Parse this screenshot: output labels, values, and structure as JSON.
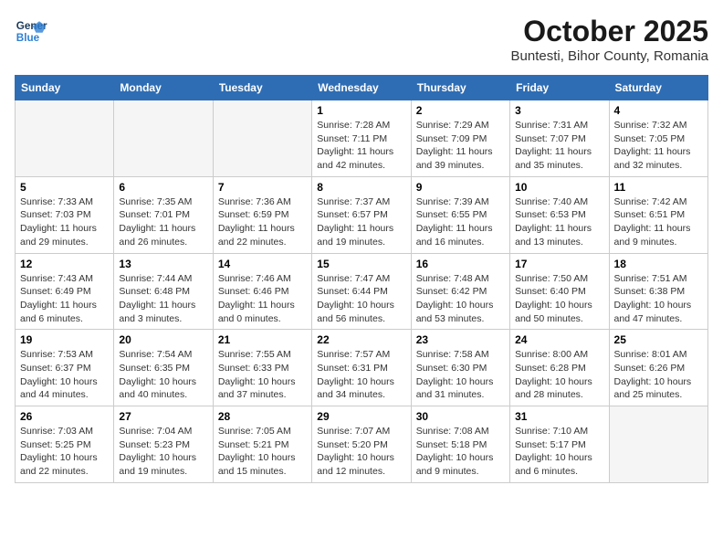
{
  "logo": {
    "line1": "General",
    "line2": "Blue"
  },
  "title": "October 2025",
  "subtitle": "Buntesti, Bihor County, Romania",
  "weekdays": [
    "Sunday",
    "Monday",
    "Tuesday",
    "Wednesday",
    "Thursday",
    "Friday",
    "Saturday"
  ],
  "weeks": [
    [
      {
        "day": "",
        "info": ""
      },
      {
        "day": "",
        "info": ""
      },
      {
        "day": "",
        "info": ""
      },
      {
        "day": "1",
        "info": "Sunrise: 7:28 AM\nSunset: 7:11 PM\nDaylight: 11 hours\nand 42 minutes."
      },
      {
        "day": "2",
        "info": "Sunrise: 7:29 AM\nSunset: 7:09 PM\nDaylight: 11 hours\nand 39 minutes."
      },
      {
        "day": "3",
        "info": "Sunrise: 7:31 AM\nSunset: 7:07 PM\nDaylight: 11 hours\nand 35 minutes."
      },
      {
        "day": "4",
        "info": "Sunrise: 7:32 AM\nSunset: 7:05 PM\nDaylight: 11 hours\nand 32 minutes."
      }
    ],
    [
      {
        "day": "5",
        "info": "Sunrise: 7:33 AM\nSunset: 7:03 PM\nDaylight: 11 hours\nand 29 minutes."
      },
      {
        "day": "6",
        "info": "Sunrise: 7:35 AM\nSunset: 7:01 PM\nDaylight: 11 hours\nand 26 minutes."
      },
      {
        "day": "7",
        "info": "Sunrise: 7:36 AM\nSunset: 6:59 PM\nDaylight: 11 hours\nand 22 minutes."
      },
      {
        "day": "8",
        "info": "Sunrise: 7:37 AM\nSunset: 6:57 PM\nDaylight: 11 hours\nand 19 minutes."
      },
      {
        "day": "9",
        "info": "Sunrise: 7:39 AM\nSunset: 6:55 PM\nDaylight: 11 hours\nand 16 minutes."
      },
      {
        "day": "10",
        "info": "Sunrise: 7:40 AM\nSunset: 6:53 PM\nDaylight: 11 hours\nand 13 minutes."
      },
      {
        "day": "11",
        "info": "Sunrise: 7:42 AM\nSunset: 6:51 PM\nDaylight: 11 hours\nand 9 minutes."
      }
    ],
    [
      {
        "day": "12",
        "info": "Sunrise: 7:43 AM\nSunset: 6:49 PM\nDaylight: 11 hours\nand 6 minutes."
      },
      {
        "day": "13",
        "info": "Sunrise: 7:44 AM\nSunset: 6:48 PM\nDaylight: 11 hours\nand 3 minutes."
      },
      {
        "day": "14",
        "info": "Sunrise: 7:46 AM\nSunset: 6:46 PM\nDaylight: 11 hours\nand 0 minutes."
      },
      {
        "day": "15",
        "info": "Sunrise: 7:47 AM\nSunset: 6:44 PM\nDaylight: 10 hours\nand 56 minutes."
      },
      {
        "day": "16",
        "info": "Sunrise: 7:48 AM\nSunset: 6:42 PM\nDaylight: 10 hours\nand 53 minutes."
      },
      {
        "day": "17",
        "info": "Sunrise: 7:50 AM\nSunset: 6:40 PM\nDaylight: 10 hours\nand 50 minutes."
      },
      {
        "day": "18",
        "info": "Sunrise: 7:51 AM\nSunset: 6:38 PM\nDaylight: 10 hours\nand 47 minutes."
      }
    ],
    [
      {
        "day": "19",
        "info": "Sunrise: 7:53 AM\nSunset: 6:37 PM\nDaylight: 10 hours\nand 44 minutes."
      },
      {
        "day": "20",
        "info": "Sunrise: 7:54 AM\nSunset: 6:35 PM\nDaylight: 10 hours\nand 40 minutes."
      },
      {
        "day": "21",
        "info": "Sunrise: 7:55 AM\nSunset: 6:33 PM\nDaylight: 10 hours\nand 37 minutes."
      },
      {
        "day": "22",
        "info": "Sunrise: 7:57 AM\nSunset: 6:31 PM\nDaylight: 10 hours\nand 34 minutes."
      },
      {
        "day": "23",
        "info": "Sunrise: 7:58 AM\nSunset: 6:30 PM\nDaylight: 10 hours\nand 31 minutes."
      },
      {
        "day": "24",
        "info": "Sunrise: 8:00 AM\nSunset: 6:28 PM\nDaylight: 10 hours\nand 28 minutes."
      },
      {
        "day": "25",
        "info": "Sunrise: 8:01 AM\nSunset: 6:26 PM\nDaylight: 10 hours\nand 25 minutes."
      }
    ],
    [
      {
        "day": "26",
        "info": "Sunrise: 7:03 AM\nSunset: 5:25 PM\nDaylight: 10 hours\nand 22 minutes."
      },
      {
        "day": "27",
        "info": "Sunrise: 7:04 AM\nSunset: 5:23 PM\nDaylight: 10 hours\nand 19 minutes."
      },
      {
        "day": "28",
        "info": "Sunrise: 7:05 AM\nSunset: 5:21 PM\nDaylight: 10 hours\nand 15 minutes."
      },
      {
        "day": "29",
        "info": "Sunrise: 7:07 AM\nSunset: 5:20 PM\nDaylight: 10 hours\nand 12 minutes."
      },
      {
        "day": "30",
        "info": "Sunrise: 7:08 AM\nSunset: 5:18 PM\nDaylight: 10 hours\nand 9 minutes."
      },
      {
        "day": "31",
        "info": "Sunrise: 7:10 AM\nSunset: 5:17 PM\nDaylight: 10 hours\nand 6 minutes."
      },
      {
        "day": "",
        "info": ""
      }
    ]
  ]
}
